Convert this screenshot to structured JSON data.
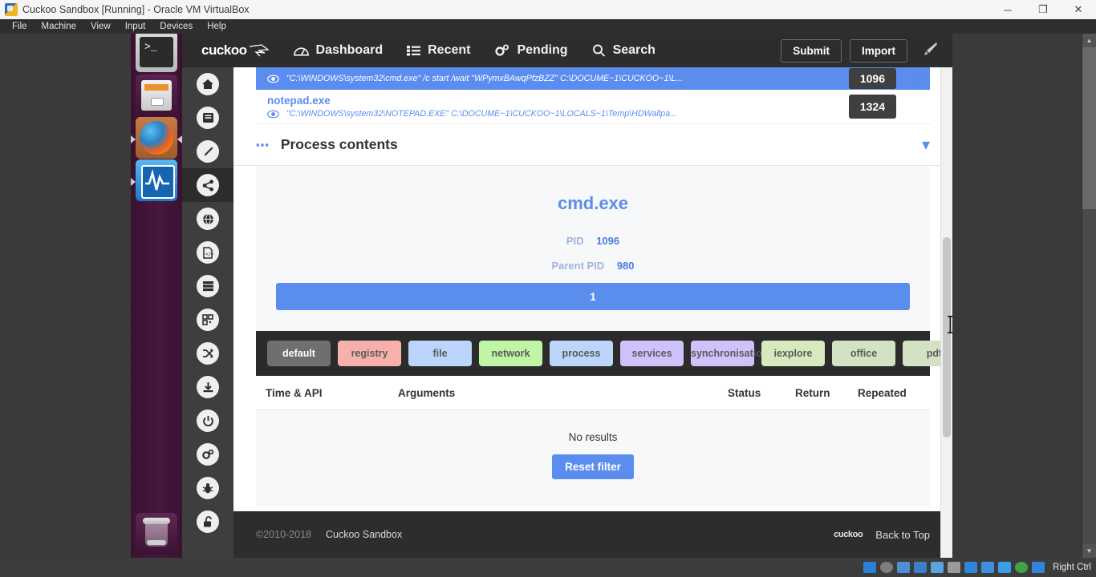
{
  "vbox": {
    "title": "Cuckoo Sandbox [Running] - Oracle VM VirtualBox",
    "app_icon": "virtualbox-icon",
    "menus": [
      "File",
      "Machine",
      "View",
      "Input",
      "Devices",
      "Help"
    ],
    "window_buttons": [
      {
        "name": "minimize-button",
        "glyph": "─"
      },
      {
        "name": "maximize-button",
        "glyph": "❐"
      },
      {
        "name": "close-button",
        "glyph": "✕"
      }
    ],
    "status": {
      "host_key": "Right Ctrl",
      "indicators": [
        "hard-disk-icon",
        "optical-disk-icon",
        "floppy-icon",
        "network-icon",
        "usb-icon",
        "shared-folder-icon",
        "display-icon",
        "video-capture-icon",
        "virtualization-icon",
        "mouse-icon",
        "keyboard-icon"
      ]
    }
  },
  "launcher": {
    "items": [
      {
        "name": "launcher-terminal",
        "label": "Terminal",
        "prompt": ">_"
      },
      {
        "name": "launcher-files",
        "label": "Files"
      },
      {
        "name": "launcher-firefox",
        "label": "Firefox"
      },
      {
        "name": "launcher-system-monitor",
        "label": "System Monitor"
      },
      {
        "name": "launcher-trash",
        "label": "Trash"
      }
    ]
  },
  "nav": {
    "logo": "cuckoo",
    "links": [
      {
        "name": "nav-dashboard",
        "label": "Dashboard",
        "icon": "dashboard-icon"
      },
      {
        "name": "nav-recent",
        "label": "Recent",
        "icon": "list-icon"
      },
      {
        "name": "nav-pending",
        "label": "Pending",
        "icon": "gears-icon"
      },
      {
        "name": "nav-search",
        "label": "Search",
        "icon": "search-icon"
      }
    ],
    "buttons": [
      {
        "name": "submit-button",
        "label": "Submit"
      },
      {
        "name": "import-button",
        "label": "Import"
      }
    ],
    "brush_icon": "brush-icon"
  },
  "rail": {
    "items": [
      {
        "name": "rail-item-home",
        "icon": "home-icon",
        "active": false
      },
      {
        "name": "rail-item-static",
        "icon": "book-icon",
        "active": false
      },
      {
        "name": "rail-item-signatures",
        "icon": "pencil-icon",
        "active": false
      },
      {
        "name": "rail-item-behavior",
        "icon": "share-icon",
        "active": true
      },
      {
        "name": "rail-item-network",
        "icon": "globe-icon",
        "active": false
      },
      {
        "name": "rail-item-source",
        "icon": "code-file-icon",
        "active": false
      },
      {
        "name": "rail-item-memory",
        "icon": "server-icon",
        "active": false
      },
      {
        "name": "rail-item-export",
        "icon": "qrcode-icon",
        "active": false
      },
      {
        "name": "rail-item-compare",
        "icon": "shuffle-icon",
        "active": false
      },
      {
        "name": "rail-item-download",
        "icon": "download-icon",
        "active": false
      },
      {
        "name": "rail-item-reboot",
        "icon": "power-icon",
        "active": false
      },
      {
        "name": "rail-item-options",
        "icon": "gears-icon",
        "active": false
      },
      {
        "name": "rail-item-debug",
        "icon": "bug-icon",
        "active": false
      },
      {
        "name": "rail-item-admin",
        "icon": "unlock-icon",
        "active": false
      }
    ]
  },
  "processes": [
    {
      "name": "cmd.exe",
      "show_name": false,
      "selected": true,
      "cmdline": "\"C:\\WINDOWS\\system32\\cmd.exe\" /c start /wait \"WPymxBAwqPfzBZZ\" C:\\DOCUME~1\\CUCKOO~1\\L...",
      "pid": "1096",
      "eye_icon": "eye-icon",
      "chevron": "chevron-down-icon"
    },
    {
      "name": "notepad.exe",
      "show_name": true,
      "selected": false,
      "cmdline": "\"C:\\WINDOWS\\system32\\NOTEPAD.EXE\" C:\\DOCUME~1\\CUCKOO~1\\LOCALS~1\\Temp\\HDWallpa...",
      "pid": "1324",
      "eye_icon": "eye-icon"
    }
  ],
  "process_contents": {
    "dots": "▪▪▪",
    "title": "Process contents",
    "caret": "❯"
  },
  "summary": {
    "process_name": "cmd.exe",
    "pid_label": "PID",
    "pid_value": "1096",
    "parent_pid_label": "Parent PID",
    "parent_pid_value": "980",
    "page_current": "1"
  },
  "filters": [
    {
      "name": "filter-default",
      "label": "default",
      "bg": "#6f6f6f",
      "fg": "#ffffff"
    },
    {
      "name": "filter-registry",
      "label": "registry",
      "bg": "#f7b0ab",
      "fg": "#5a5a5a"
    },
    {
      "name": "filter-file",
      "label": "file",
      "bg": "#bcd5fb",
      "fg": "#5a5a5a"
    },
    {
      "name": "filter-network",
      "label": "network",
      "bg": "#bff5a4",
      "fg": "#5a5a5a"
    },
    {
      "name": "filter-process",
      "label": "process",
      "bg": "#bcd5fb",
      "fg": "#5a5a5a"
    },
    {
      "name": "filter-services",
      "label": "services",
      "bg": "#cfc1fb",
      "fg": "#5a5a5a"
    },
    {
      "name": "filter-synchronisation",
      "label": "synchronisation",
      "bg": "#cfc1fb",
      "fg": "#5a5a5a"
    },
    {
      "name": "filter-iexplore",
      "label": "iexplore",
      "bg": "#d8e8bf",
      "fg": "#5a5a5a"
    },
    {
      "name": "filter-office",
      "label": "office",
      "bg": "#d3e2c2",
      "fg": "#5a5a5a"
    },
    {
      "name": "filter-pdf",
      "label": "pdf",
      "bg": "#d3e2c2",
      "fg": "#5a5a5a"
    }
  ],
  "table": {
    "columns": [
      "Time & API",
      "Arguments",
      "Status",
      "Return",
      "Repeated"
    ],
    "empty_text": "No results",
    "reset_label": "Reset filter",
    "rows": []
  },
  "footer": {
    "copyright": "©2010-2018",
    "brand": "Cuckoo Sandbox",
    "logo": "cuckoo",
    "back_to_top": "Back to Top"
  }
}
